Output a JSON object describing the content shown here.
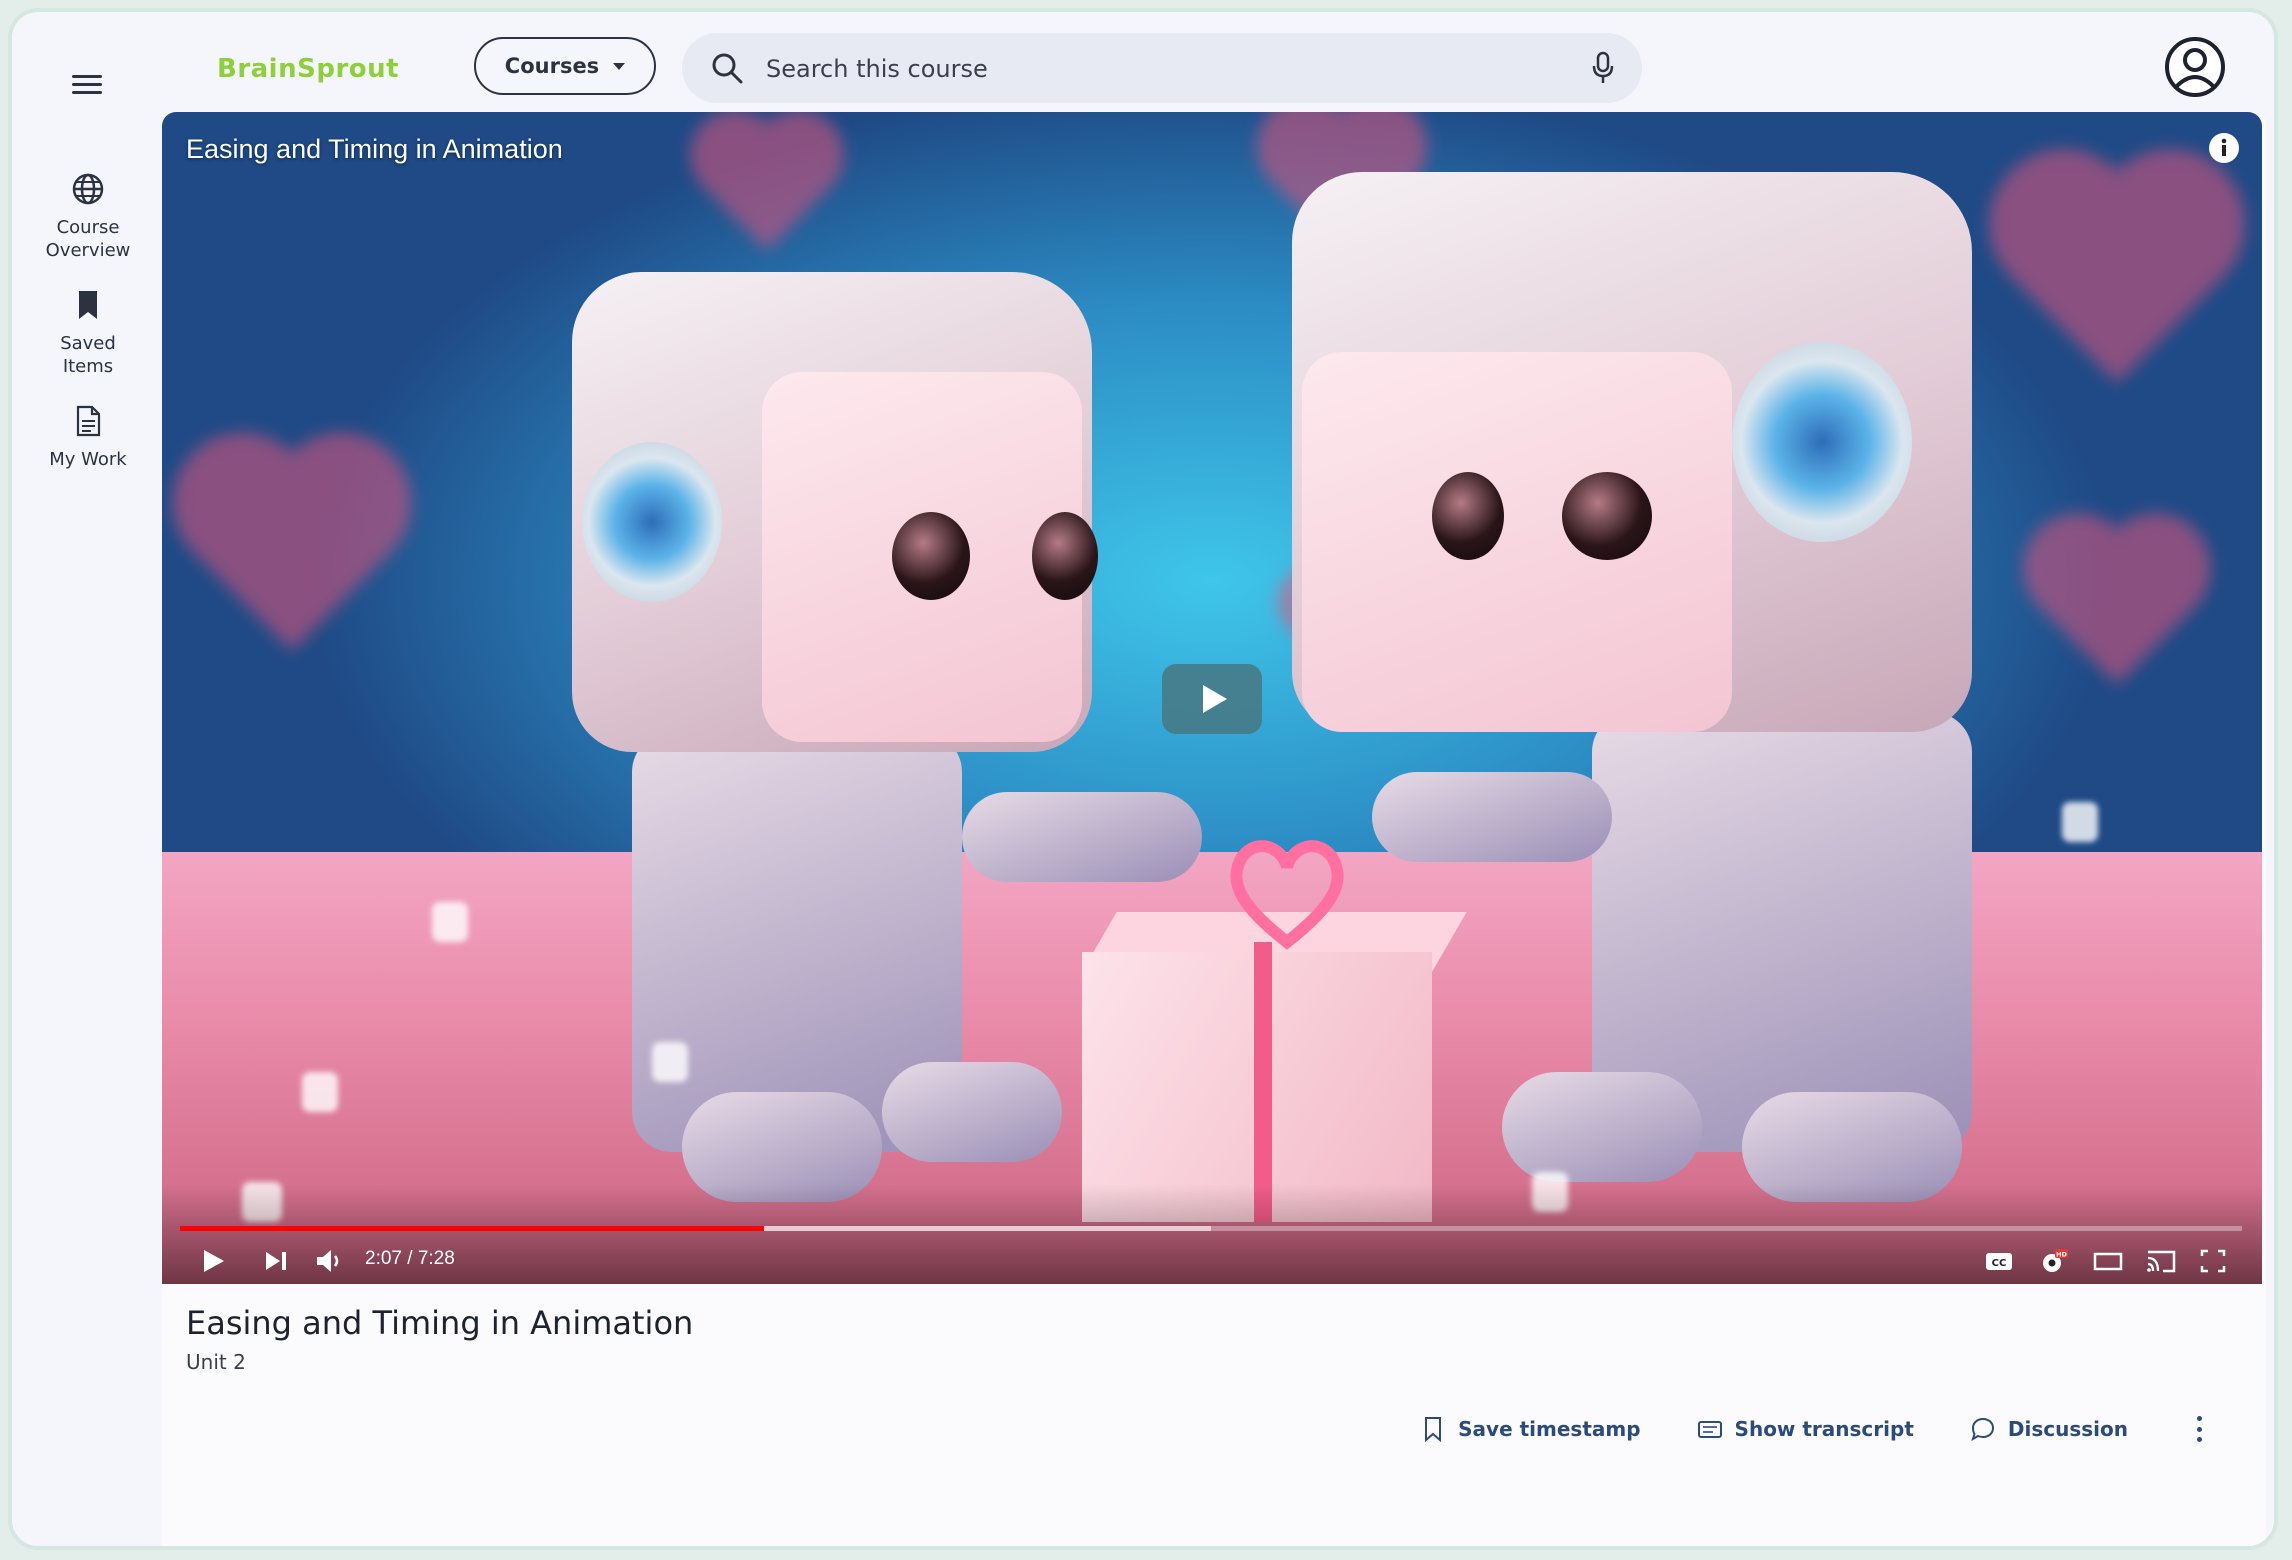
{
  "brand": {
    "name": "BrainSprout",
    "color": "#8fcf3a"
  },
  "header": {
    "courses_label": "Courses",
    "search_placeholder": "Search this course"
  },
  "sidebar": {
    "items": [
      {
        "label": "Course\nOverview",
        "icon": "globe-icon"
      },
      {
        "label": "Saved\nItems",
        "icon": "bookmark-icon"
      },
      {
        "label": "My Work",
        "icon": "document-icon"
      }
    ]
  },
  "video": {
    "title": "Easing and Timing in Animation",
    "current_time": "2:07",
    "duration": "7:28",
    "time_display": "2:07 / 7:28",
    "progress": 0.283,
    "buffered": 0.5,
    "accent": "#ff0000"
  },
  "lesson": {
    "title": "Easing and Timing in Animation",
    "unit": "Unit 2"
  },
  "actions": {
    "save_timestamp": "Save timestamp",
    "show_transcript": "Show transcript",
    "discussion": "Discussion"
  }
}
